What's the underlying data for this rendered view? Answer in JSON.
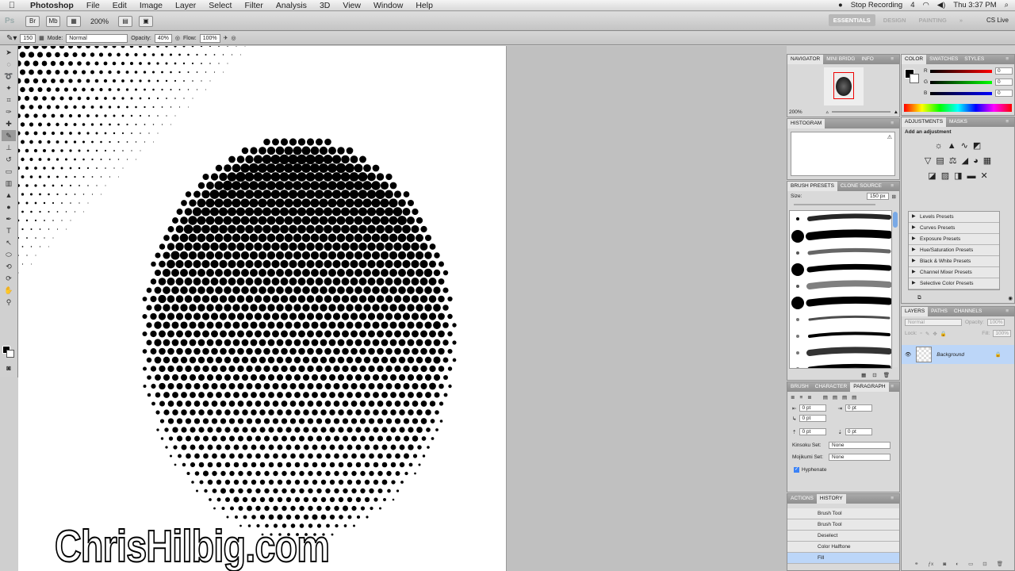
{
  "menubar": {
    "app": "Photoshop",
    "items": [
      "File",
      "Edit",
      "Image",
      "Layer",
      "Select",
      "Filter",
      "Analysis",
      "3D",
      "View",
      "Window",
      "Help"
    ],
    "right": {
      "recording": "Stop Recording",
      "badge": "4",
      "clock": "Thu 3:37 PM"
    }
  },
  "appbar": {
    "zoom": "200%",
    "workspaces": [
      "ESSENTIALS",
      "DESIGN",
      "PAINTING"
    ],
    "more": "»",
    "cslive": "CS Live"
  },
  "options": {
    "brush_size": "150",
    "mode_label": "Mode:",
    "mode_value": "Normal",
    "opacity_label": "Opacity:",
    "opacity_value": "40%",
    "flow_label": "Flow:",
    "flow_value": "100%"
  },
  "navigator": {
    "tabs": [
      "NAVIGATOR",
      "MINI BRIDG",
      "INFO"
    ],
    "zoom": "200%"
  },
  "histogram": {
    "tab": "HISTOGRAM"
  },
  "brush_presets": {
    "tabs": [
      "BRUSH PRESETS",
      "CLONE SOURCE"
    ],
    "size_label": "Size:",
    "size_value": "150 px"
  },
  "paragraph": {
    "tabs": [
      "BRUSH",
      "CHARACTER",
      "PARAGRAPH"
    ],
    "indent_left": "0 pt",
    "indent_right": "0 pt",
    "first_line": "0 pt",
    "space_before": "0 pt",
    "space_after": "0 pt",
    "kinsoku_label": "Kinsoku Set:",
    "kinsoku_value": "None",
    "mojikumi_label": "Mojikumi Set:",
    "mojikumi_value": "None",
    "hyphenate": "Hyphenate"
  },
  "history": {
    "tabs": [
      "ACTIONS",
      "HISTORY"
    ],
    "items": [
      "Brush Tool",
      "Brush Tool",
      "Deselect",
      "Color Halftone",
      "Fill"
    ]
  },
  "color": {
    "tabs": [
      "COLOR",
      "SWATCHES",
      "STYLES"
    ],
    "r_label": "R",
    "g_label": "G",
    "b_label": "B",
    "r": "0",
    "g": "0",
    "b": "0"
  },
  "adjustments": {
    "tabs": [
      "ADJUSTMENTS",
      "MASKS"
    ],
    "title": "Add an adjustment",
    "presets": [
      "Levels Presets",
      "Curves Presets",
      "Exposure Presets",
      "Hue/Saturation Presets",
      "Black & White Presets",
      "Channel Mixer Presets",
      "Selective Color Presets"
    ]
  },
  "layers": {
    "tabs": [
      "LAYERS",
      "PATHS",
      "CHANNELS"
    ],
    "blend": "Normal",
    "opacity_label": "Opacity:",
    "opacity": "100%",
    "lock_label": "Lock:",
    "fill_label": "Fill:",
    "fill": "100%",
    "layer_name": "Background"
  },
  "watermark": "ChrisHilbig.com"
}
